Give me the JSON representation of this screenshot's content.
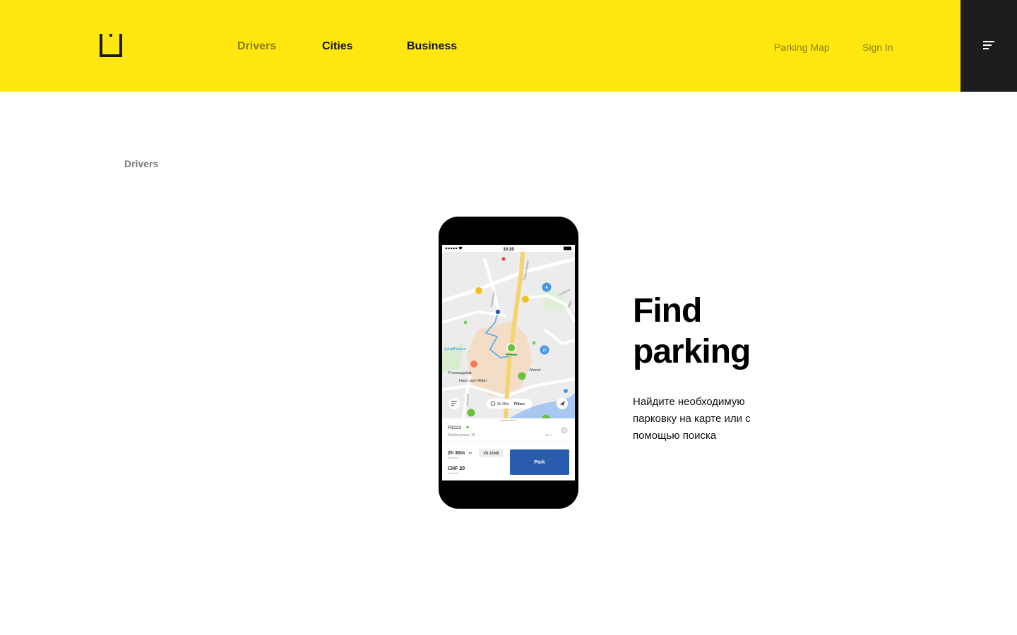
{
  "header": {
    "nav": {
      "drivers": "Drivers",
      "cities": "Cities",
      "business": "Business"
    },
    "parking_map": "Parking Map",
    "sign_in": "Sign In",
    "brand_color": "#ffe70f",
    "menu_bg": "#1d1d1d"
  },
  "breadcrumb": "Drivers",
  "hero": {
    "title": "Find parking",
    "description": "Найдите необходимую парковку на карте или с помощью поиска"
  },
  "phone": {
    "status_time": "10:20",
    "map_labels": {
      "schaffhausen": "Schaffhausen",
      "fronwagplatz": "Fronwagplatz",
      "haus_zum_ritter": "Haus zum Ritter",
      "munot": "Munot",
      "fulachstrasse": "Fulachstrasse",
      "neustadt": "Neustadt",
      "hochstrasse": "Hochstrasse",
      "grabenstr": "Grabenstr",
      "tellstr": "Tellstr"
    },
    "cluster_4": "4",
    "cluster_27": "27",
    "duration_chip": "2h 30m",
    "filters": "Filters",
    "zone_code": "R1023",
    "address": "Repfergasse 16",
    "distance": "35 m",
    "duration_value": "2h 30m",
    "duration_label": "Duration",
    "plate": "VS 12345",
    "cost_value": "CHF 20",
    "cost_label": "Cost est.",
    "park_button": "Park",
    "accent": "#2a5cad"
  }
}
